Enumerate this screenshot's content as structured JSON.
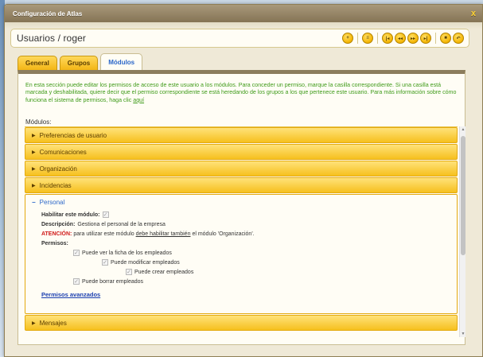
{
  "window": {
    "title": "Configuración de Atlas",
    "close_glyph": "x"
  },
  "header": {
    "title": "Usuarios / roger",
    "toolbar": [
      {
        "icon": "add-icon",
        "glyph": "+"
      },
      {
        "icon": "list-icon",
        "glyph": "≡"
      },
      {
        "icon": "first-icon",
        "glyph": "|◂"
      },
      {
        "icon": "prev-icon",
        "glyph": "◂◂"
      },
      {
        "icon": "next-icon",
        "glyph": "▸▸"
      },
      {
        "icon": "last-icon",
        "glyph": "▸|"
      },
      {
        "icon": "save-icon",
        "glyph": "■"
      },
      {
        "icon": "undo-icon",
        "glyph": "↶"
      }
    ]
  },
  "tabs": [
    {
      "label": "General",
      "active": false
    },
    {
      "label": "Grupos",
      "active": false
    },
    {
      "label": "Módulos",
      "active": true
    }
  ],
  "intro": {
    "text": "En esta sección puede editar los permisos de acceso de este usuario a los módulos. Para conceder un permiso, marque la casilla correspondiente. Si una casilla está marcada y deshabilitada, quiere decir que el permiso correspondiente se está heredando de los grupos a los que pertenece este usuario. Para más información sobre cómo funciona el sistema de permisos, haga clic",
    "link": "aquí"
  },
  "modules_label": "Módulos:",
  "modules": [
    {
      "label": "Preferencias de usuario"
    },
    {
      "label": "Comunicaciones"
    },
    {
      "label": "Organización"
    },
    {
      "label": "Incidencias"
    }
  ],
  "open_module": {
    "label": "Personal",
    "enable_label": "Habilitar este módulo:",
    "description_label": "Descripción:",
    "description": "Gestiona el personal de la empresa",
    "warning_label": "ATENCIÓN:",
    "warning_pre": "para utilizar este módulo",
    "warning_link": "debe habilitar también",
    "warning_post": "el módulo 'Organización'.",
    "permissions_label": "Permisos:",
    "permissions": [
      {
        "label": "Puede ver la ficha de los empleados"
      },
      {
        "label": "Puede modificar empleados"
      },
      {
        "label": "Puede crear empleados"
      },
      {
        "label": "Puede borrar empleados"
      }
    ],
    "advanced_link": "Permisos avanzados"
  },
  "next_module": {
    "label": "Mensajes"
  }
}
